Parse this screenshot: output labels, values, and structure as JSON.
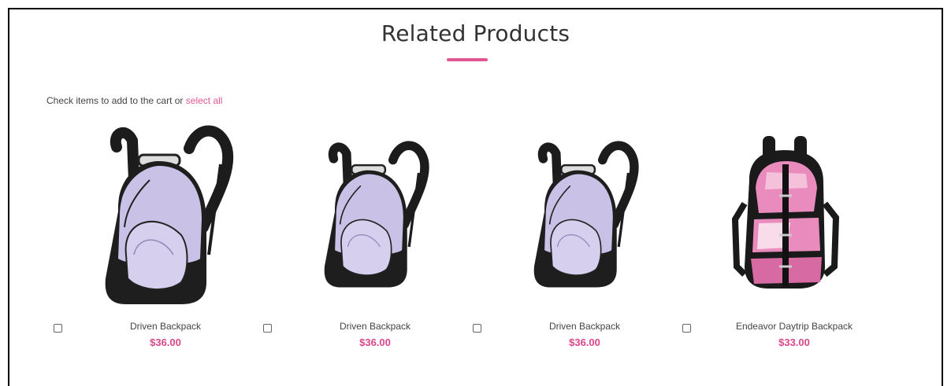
{
  "section": {
    "title": "Related Products",
    "instruction": "Check items to add to the cart or",
    "select_all": "select all"
  },
  "colors": {
    "accent": "#e0588f",
    "price": "#d9468a",
    "lavender": "#c9c2e6",
    "pink": "#e98bbd"
  },
  "products": [
    {
      "name": "Driven Backpack",
      "price": "$36.00",
      "image_icon": "lavender-backpack-icon"
    },
    {
      "name": "Driven Backpack",
      "price": "$36.00",
      "image_icon": "lavender-backpack-icon"
    },
    {
      "name": "Driven Backpack",
      "price": "$36.00",
      "image_icon": "lavender-backpack-icon"
    },
    {
      "name": "Endeavor Daytrip Backpack",
      "price": "$33.00",
      "image_icon": "pink-backpack-icon"
    }
  ]
}
